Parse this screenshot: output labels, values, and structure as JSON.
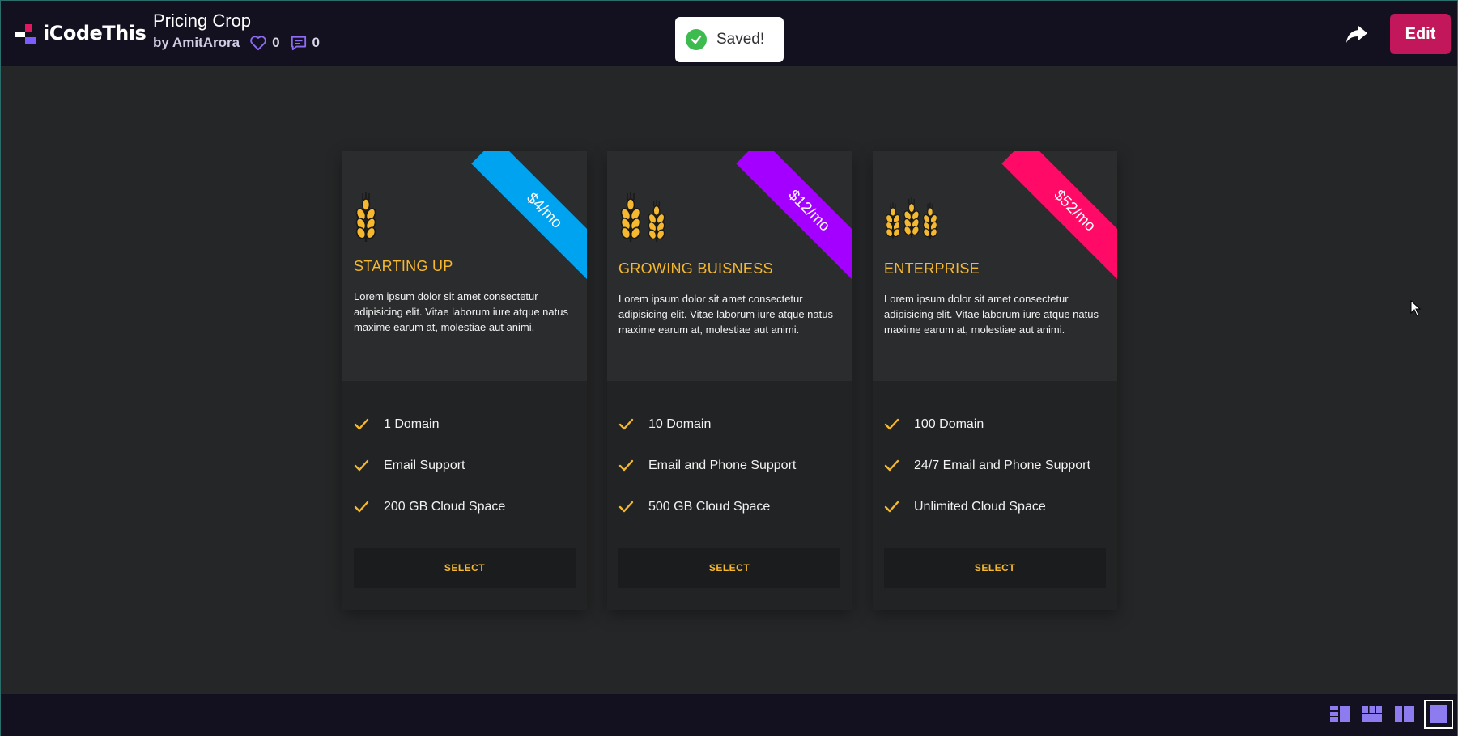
{
  "header": {
    "logo_text": "iCodeThis",
    "title": "Pricing Crop",
    "author": "by AmitArora",
    "likes": "0",
    "comments": "0",
    "edit_label": "Edit"
  },
  "toast": {
    "text": "Saved!"
  },
  "colors": {
    "accent_yellow": "#f5b82e",
    "ribbon_blue": "#00a3f0",
    "ribbon_purple": "#a300ff",
    "ribbon_pink": "#ff0a66",
    "edit_button": "#c2185b"
  },
  "cards": [
    {
      "price": "$4/mo",
      "name": "STARTING UP",
      "description": "Lorem ipsum dolor sit amet consectetur adipisicing elit. Vitae laborum iure atque natus maxime earum at, molestiae aut animi.",
      "features": [
        "1 Domain",
        "Email Support",
        "200 GB Cloud Space"
      ],
      "button": "SELECT",
      "icon": "wheat-icon"
    },
    {
      "price": "$12/mo",
      "name": "GROWING BUISNESS",
      "description": "Lorem ipsum dolor sit amet consectetur adipisicing elit. Vitae laborum iure atque natus maxime earum at, molestiae aut animi.",
      "features": [
        "10 Domain",
        "Email and Phone Support",
        "500 GB Cloud Space"
      ],
      "button": "SELECT",
      "icon": "wheat-icon"
    },
    {
      "price": "$52/mo",
      "name": "ENTERPRISE",
      "description": "Lorem ipsum dolor sit amet consectetur adipisicing elit. Vitae laborum iure atque natus maxime earum at, molestiae aut animi.",
      "features": [
        "100 Domain",
        "24/7 Email and Phone Support",
        "Unlimited Cloud Space"
      ],
      "button": "SELECT",
      "icon": "wheat-icon"
    }
  ],
  "view_modes": [
    "layout-split-icon",
    "layout-grid-icon",
    "layout-side-icon",
    "layout-full-icon"
  ],
  "active_view": "layout-full-icon"
}
